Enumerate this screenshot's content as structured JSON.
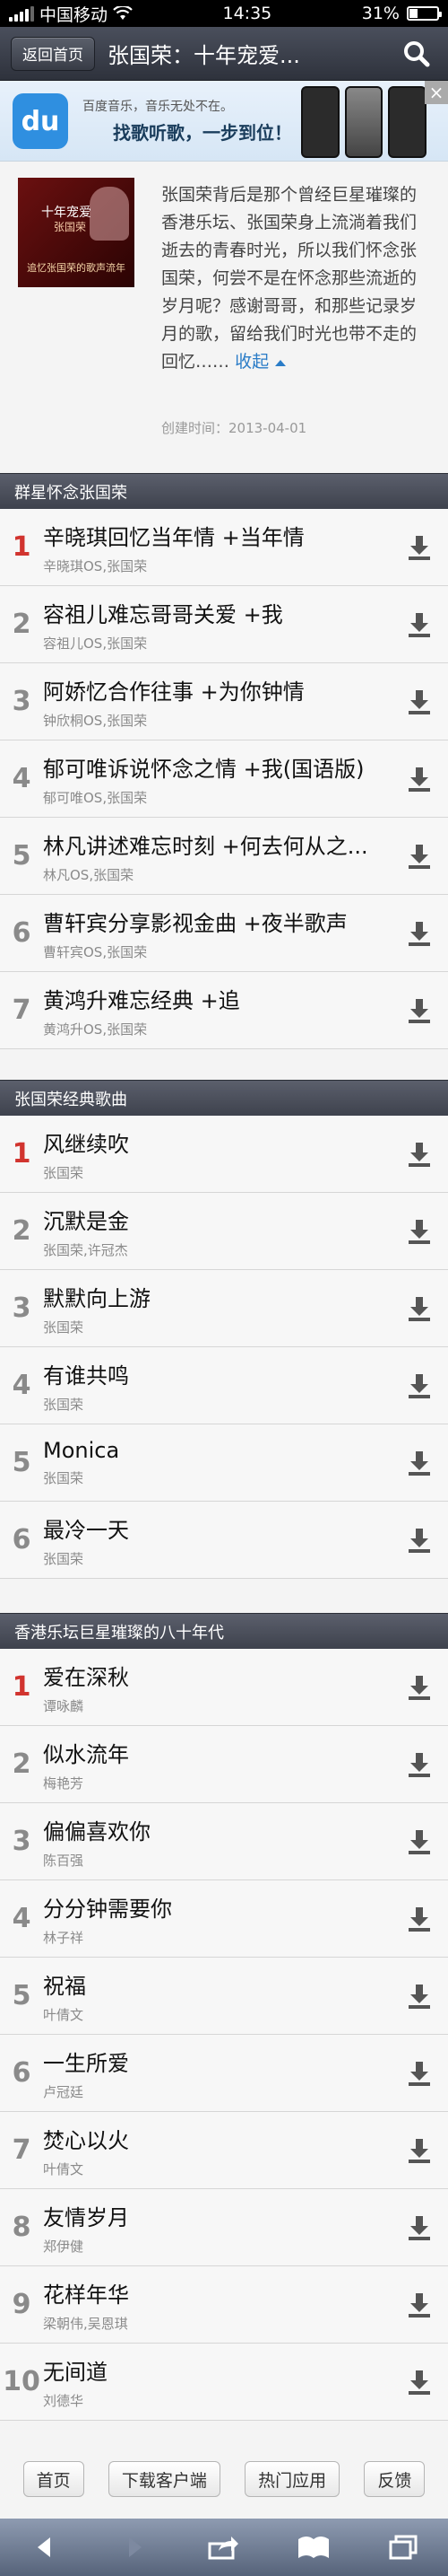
{
  "status_bar": {
    "carrier": "中国移动",
    "time": "14:35",
    "battery": "31%"
  },
  "nav": {
    "back_label": "返回首页",
    "title": "张国荣：十年宠爱..."
  },
  "banner": {
    "line1": "百度音乐，音乐无处不在。",
    "line2": "找歌听歌，一步到位！"
  },
  "album": {
    "cover_title": "十年宠爱",
    "cover_subtitle": "张国荣",
    "cover_caption": "追忆张国荣的歌声流年",
    "description": "张国荣背后是那个曾经巨星璀璨的香港乐坛、张国荣身上流淌着我们逝去的青春时光，所以我们怀念张国荣，何尝不是在怀念那些流逝的岁月呢？感谢哥哥，和那些记录岁月的歌，留给我们时光也带不走的回忆……",
    "collapse_label": "收起",
    "created": "创建时间：2013-04-01"
  },
  "sections": [
    {
      "title": "群星怀念张国荣",
      "songs": [
        {
          "rank": "1",
          "name": "辛晓琪回忆当年情 +当年情",
          "artist": "辛晓琪OS,张国荣"
        },
        {
          "rank": "2",
          "name": "容祖儿难忘哥哥关爱 +我",
          "artist": "容祖儿OS,张国荣"
        },
        {
          "rank": "3",
          "name": "阿娇忆合作往事 +为你钟情",
          "artist": "钟欣桐OS,张国荣"
        },
        {
          "rank": "4",
          "name": "郁可唯诉说怀念之情 +我(国语版)",
          "artist": "郁可唯OS,张国荣"
        },
        {
          "rank": "5",
          "name": "林凡讲述难忘时刻 +何去何从之...",
          "artist": "林凡OS,张国荣"
        },
        {
          "rank": "6",
          "name": "曹轩宾分享影视金曲 +夜半歌声",
          "artist": "曹轩宾OS,张国荣"
        },
        {
          "rank": "7",
          "name": "黄鸿升难忘经典 +追",
          "artist": "黄鸿升OS,张国荣"
        }
      ]
    },
    {
      "title": "张国荣经典歌曲",
      "songs": [
        {
          "rank": "1",
          "name": "风继续吹",
          "artist": "张国荣"
        },
        {
          "rank": "2",
          "name": "沉默是金",
          "artist": "张国荣,许冠杰"
        },
        {
          "rank": "3",
          "name": "默默向上游",
          "artist": "张国荣"
        },
        {
          "rank": "4",
          "name": "有谁共鸣",
          "artist": "张国荣"
        },
        {
          "rank": "5",
          "name": "Monica",
          "artist": "张国荣"
        },
        {
          "rank": "6",
          "name": "最冷一天",
          "artist": "张国荣"
        }
      ]
    },
    {
      "title": "香港乐坛巨星璀璨的八十年代",
      "songs": [
        {
          "rank": "1",
          "name": "爱在深秋",
          "artist": "谭咏麟"
        },
        {
          "rank": "2",
          "name": "似水流年",
          "artist": "梅艳芳"
        },
        {
          "rank": "3",
          "name": "偏偏喜欢你",
          "artist": "陈百强"
        },
        {
          "rank": "4",
          "name": "分分钟需要你",
          "artist": "林子祥"
        },
        {
          "rank": "5",
          "name": "祝福",
          "artist": "叶倩文"
        },
        {
          "rank": "6",
          "name": "一生所爱",
          "artist": "卢冠廷"
        },
        {
          "rank": "7",
          "name": "焚心以火",
          "artist": "叶倩文"
        },
        {
          "rank": "8",
          "name": "友情岁月",
          "artist": "郑伊健"
        },
        {
          "rank": "9",
          "name": "花样年华",
          "artist": "梁朝伟,吴恩琪"
        },
        {
          "rank": "10",
          "name": "无间道",
          "artist": "刘德华"
        }
      ]
    }
  ],
  "footer": {
    "home": "首页",
    "download_client": "下载客户端",
    "hot_apps": "热门应用",
    "feedback": "反馈"
  },
  "icons": {
    "search": "search-icon",
    "download": "download-icon",
    "close": "close-icon"
  },
  "colors": {
    "top_rank": "#d1342f",
    "link": "#2a7cc7",
    "nav_bg": "#3e424d"
  }
}
